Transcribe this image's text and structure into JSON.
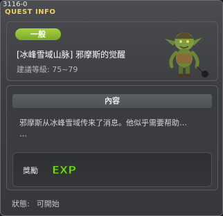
{
  "window": {
    "quest_id": "3116-0",
    "title": "QUEST INFO"
  },
  "quest": {
    "category_badge": "一般",
    "name": "[冰峰雪域山脉] 邪摩斯的觉醒",
    "level_range": "建議等級: 75~79",
    "monster_icon": "goblin-icon"
  },
  "content": {
    "header": "內容",
    "text_line1": "邪摩斯从冰峰雪域传来了消息。他似乎需要帮助…",
    "text_line2": "…"
  },
  "reward": {
    "label": "獎勵",
    "exp_icon": "exp-icon"
  },
  "status": {
    "label": "狀態:",
    "value": "可開始"
  },
  "colors": {
    "title": "#f0d060",
    "badge": "#8cbc32",
    "exp_green": "#7cd82a"
  }
}
